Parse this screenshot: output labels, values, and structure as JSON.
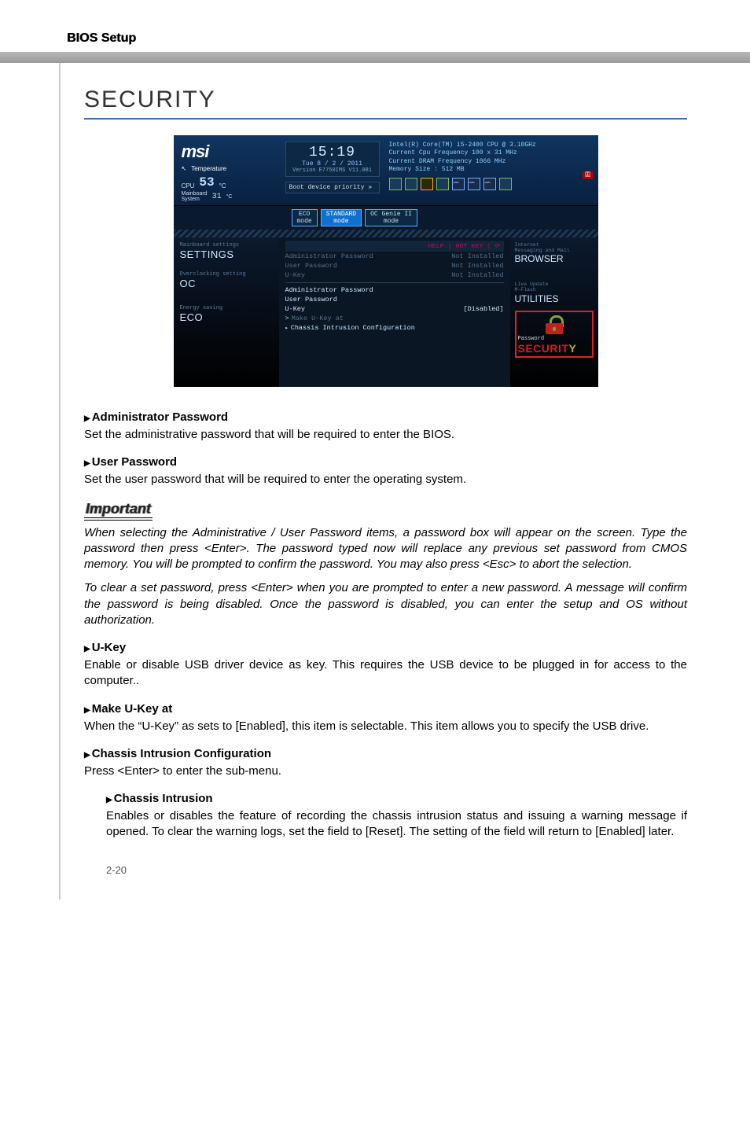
{
  "doc": {
    "header": "BIOS Setup",
    "section": "SECURITY",
    "page_number": "2-20"
  },
  "bios": {
    "logo": "msi",
    "temperature_label": "Temperature",
    "cpu_label": "CPU",
    "cpu_temp": "53",
    "cpu_unit": "°C",
    "mb_label": "Mainboard\nSystem",
    "mb_temp": "31",
    "mb_unit": "°C",
    "clock": {
      "time": "15:19",
      "date": "Tue  8 / 2 / 2011",
      "version": "Version E7750IMS V11.0B1"
    },
    "boot_label": "Boot device priority  »",
    "system_info": {
      "cpu": "Intel(R) Core(TM) i5-2400 CPU @ 3.10GHz",
      "cpu_freq": "Current Cpu Frequency 100 x 31 MHz",
      "dram_freq": "Current DRAM Frequency 1066 MHz",
      "mem": "Memory Size : 512 MB"
    },
    "lang_flag": "囯",
    "modes": {
      "eco": "ECO\nmode",
      "standard": "STANDARD\nmode",
      "genie": "OC Genie II\nmode"
    },
    "help_bar": "HELP | HOT KEY | ⟳",
    "left_menu": {
      "settings_caption": "Mainboard settings",
      "settings": "SETTINGS",
      "oc_caption": "Overclocking setting",
      "oc": "OC",
      "eco_caption": "Energy saving",
      "eco": "ECO"
    },
    "center": {
      "admin_pw_top": "Administrator Password",
      "user_pw_top": "User Password",
      "unknown_row": "U-Key",
      "not_installed": "Not Installed",
      "not_installed2": "Not Installed",
      "not_installed3": "Not Installed",
      "admin_pw": "Administrator Password",
      "user_pw": "User Password",
      "ukey": "U-Key",
      "ukey_val": "[Disabled]",
      "make_ukey": "Make U-Key at",
      "chassis": "Chassis Intrusion Configuration"
    },
    "right_menu": {
      "browser_caption": "Internet\nMessaging and Mail",
      "browser": "BROWSER",
      "util_caption": "Live Update\nM-Flash",
      "util": "UTILITIES",
      "sec_caption": "Password",
      "sec": "SECURIT",
      "sec_last": "Y"
    }
  },
  "text": {
    "admin_head": "Administrator Password",
    "admin_body": "Set the administrative password that will be required to enter the BIOS.",
    "user_head": "User Password",
    "user_body": "Set the user password that will be required to enter the operating system.",
    "important": "Important",
    "imp_p1": "When selecting the Administrative / User Password items, a password box will appear on the screen. Type the password then press <Enter>. The password typed now will replace any previous set password from CMOS memory. You will be prompted to confirm the password. You may also press <Esc> to abort the selection.",
    "imp_p2": "To clear a set password, press <Enter> when you are prompted to enter a new password. A message will confirm the password is being disabled. Once the password is disabled, you can enter the setup and OS without authorization.",
    "ukey_head": "U-Key",
    "ukey_body": "Enable or disable USB driver device as key. This requires the USB device to be plugged in for access to the computer..",
    "makeukey_head": "Make U-Key at",
    "makeukey_body": "When the “U-Key” as sets to [Enabled], this item is selectable. This item allows you to specify the USB drive.",
    "chassiscfg_head": "Chassis Intrusion Configuration",
    "chassiscfg_body": "Press <Enter> to enter the sub-menu.",
    "chassis_head": "Chassis Intrusion",
    "chassis_body": "Enables or disables the feature of recording the chassis intrusion status and issuing a warning message if opened. To clear the warning logs, set the field to [Reset]. The setting of the field will return to [Enabled] later."
  }
}
